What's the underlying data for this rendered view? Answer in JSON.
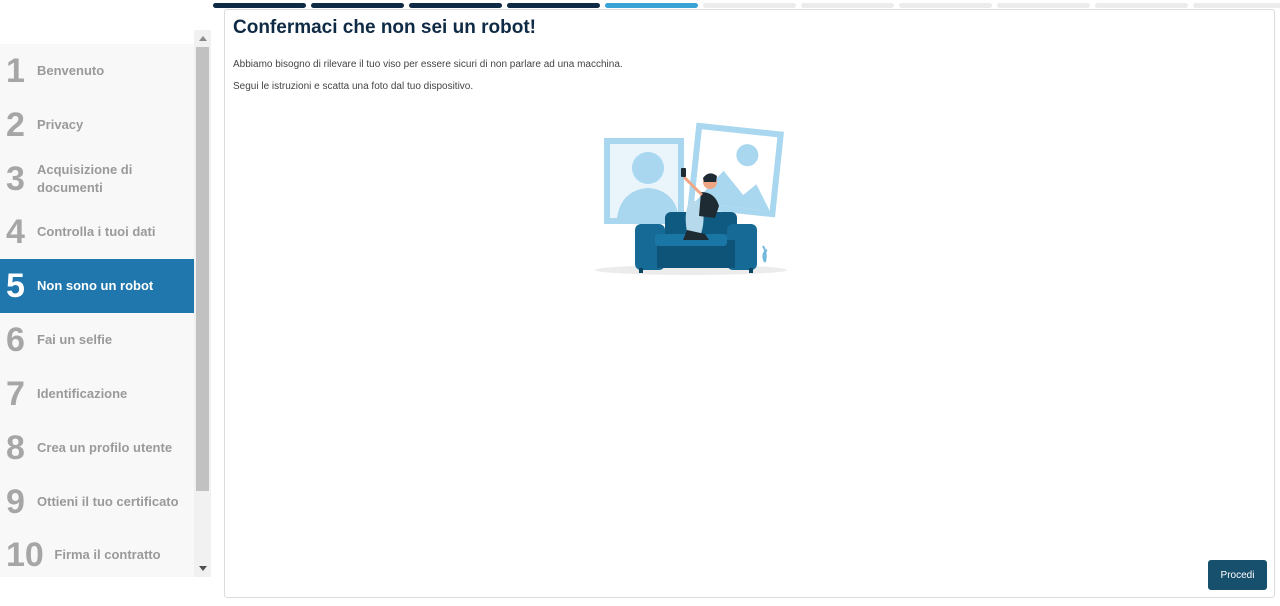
{
  "progress": {
    "total_steps": 11,
    "done_steps": 4,
    "current_step": 5
  },
  "colors": {
    "primary": "#0f2a44",
    "active": "#1f77ad",
    "accent": "#3aa3d6",
    "button": "#17506d"
  },
  "sidebar": {
    "steps": [
      {
        "num": "1",
        "label": "Benvenuto"
      },
      {
        "num": "2",
        "label": "Privacy"
      },
      {
        "num": "3",
        "label": "Acquisizione di documenti"
      },
      {
        "num": "4",
        "label": "Controlla i tuoi dati"
      },
      {
        "num": "5",
        "label": "Non sono un robot"
      },
      {
        "num": "6",
        "label": "Fai un selfie"
      },
      {
        "num": "7",
        "label": "Identificazione"
      },
      {
        "num": "8",
        "label": "Crea un profilo utente"
      },
      {
        "num": "9",
        "label": "Ottieni il tuo certificato"
      },
      {
        "num": "10",
        "label": "Firma il contratto"
      }
    ]
  },
  "main": {
    "title": "Confermaci che non sei un robot!",
    "paragraph1": "Abbiamo bisogno di rilevare il tuo viso per essere sicuri di non parlare ad una macchina.",
    "paragraph2": "Segui le istruzioni e scatta una foto dal tuo dispositivo.",
    "illustration_icon": "selfie-on-sofa-illustration",
    "proceed_label": "Procedi"
  }
}
